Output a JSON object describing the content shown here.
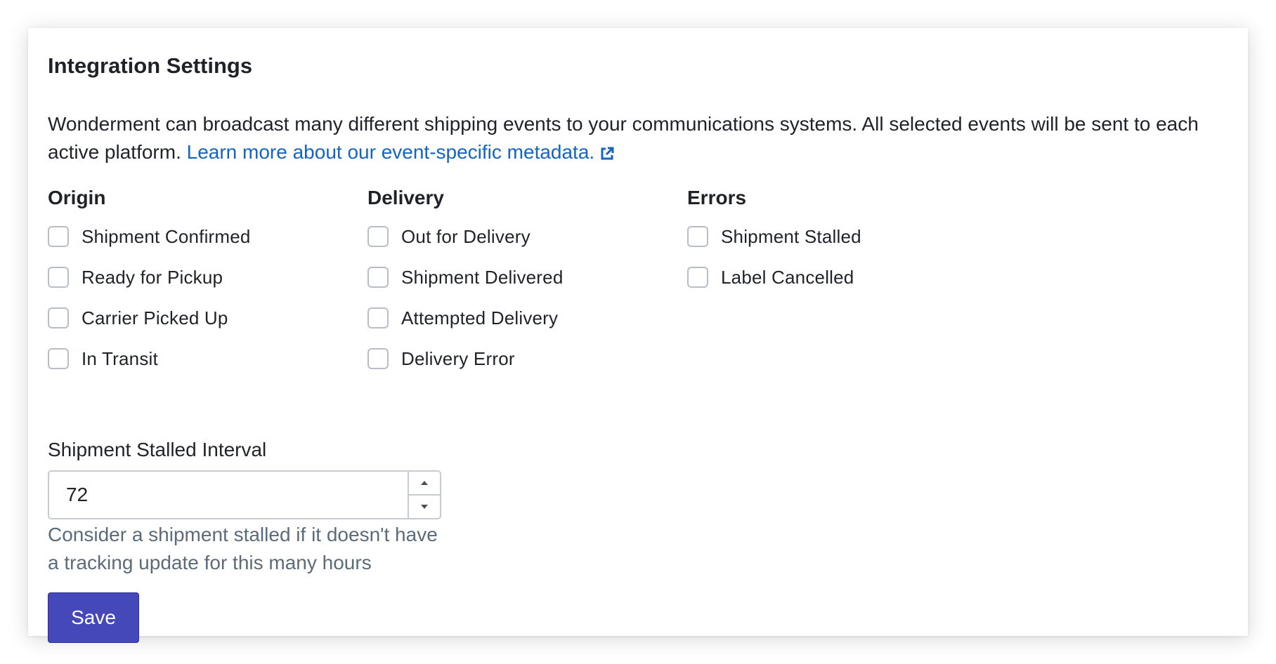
{
  "card": {
    "title": "Integration Settings",
    "description": "Wonderment can broadcast many different shipping events to your communications systems. All selected events will be sent to each active platform. ",
    "learn_more_link": "Learn more about our event-specific metadata.",
    "link_icon": "external-link-icon",
    "accent_color": "#1565c0"
  },
  "columns": [
    {
      "heading": "Origin",
      "options": [
        {
          "label": "Shipment Confirmed",
          "checked": false
        },
        {
          "label": "Ready for Pickup",
          "checked": false
        },
        {
          "label": "Carrier Picked Up",
          "checked": false
        },
        {
          "label": "In Transit",
          "checked": false
        }
      ]
    },
    {
      "heading": "Delivery",
      "options": [
        {
          "label": "Out for Delivery",
          "checked": false
        },
        {
          "label": "Shipment Delivered",
          "checked": false
        },
        {
          "label": "Attempted Delivery",
          "checked": false
        },
        {
          "label": "Delivery Error",
          "checked": false
        }
      ]
    },
    {
      "heading": "Errors",
      "options": [
        {
          "label": "Shipment Stalled",
          "checked": false
        },
        {
          "label": "Label Cancelled",
          "checked": false
        }
      ]
    }
  ],
  "stalled_interval": {
    "label": "Shipment Stalled Interval",
    "value": "72",
    "help": "Consider a shipment stalled if it doesn't have a tracking update for this many hours",
    "increment_icon": "caret-up-icon",
    "decrement_icon": "caret-down-icon"
  },
  "save_button": {
    "label": "Save",
    "color": "#4548b8"
  }
}
